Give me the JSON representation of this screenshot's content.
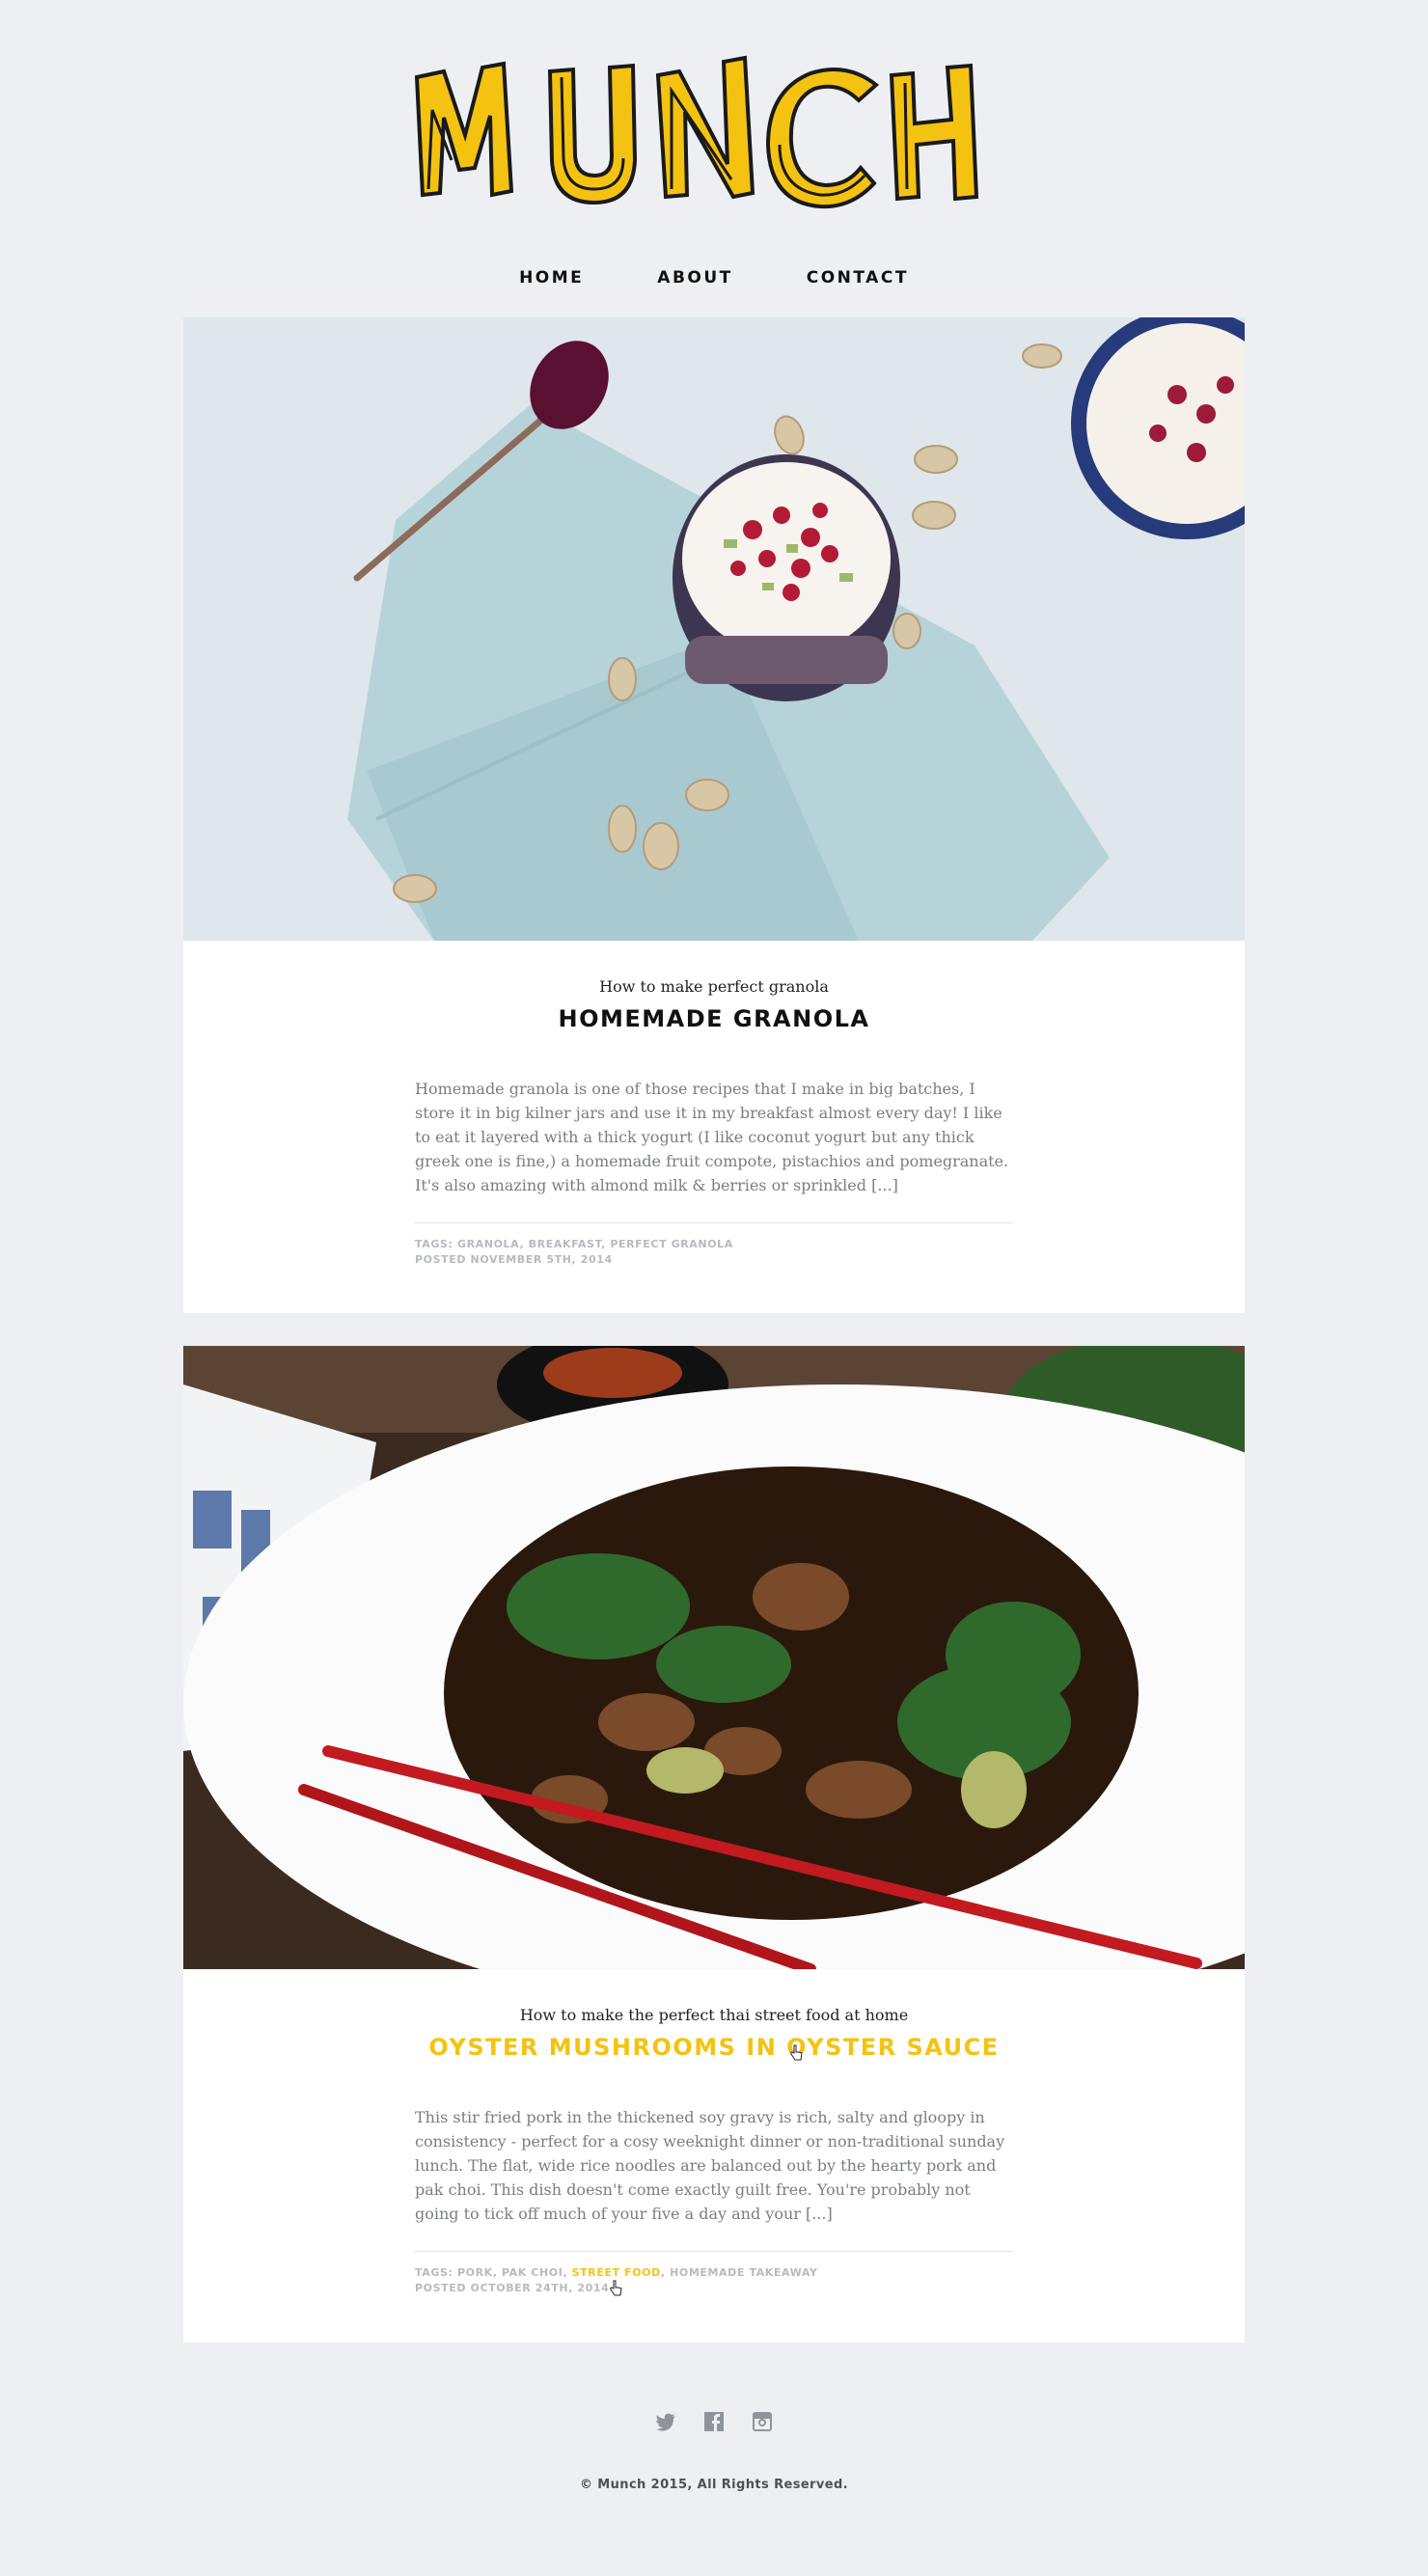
{
  "brand": {
    "logo_text": "MUNCH",
    "accent_color": "#f4c311",
    "background_color": "#edeff3"
  },
  "nav": {
    "items": [
      {
        "label": "HOME"
      },
      {
        "label": "ABOUT"
      },
      {
        "label": "CONTACT"
      }
    ]
  },
  "posts": [
    {
      "subtitle": "How to make perfect granola",
      "title": "HOMEMADE GRANOLA",
      "image_icon": "granola-jar-photo",
      "excerpt": "Homemade granola is one of those recipes that I make in big batches, I store it in big kilner jars and use it in my breakfast almost every day! I like to eat it layered with a thick yogurt (I like coconut yogurt but any thick greek one is fine,) a homemade fruit compote, pistachios and pomegranate. It's also amazing with almond milk & berries or sprinkled [...]",
      "tags_label": "TAGS:",
      "tags": [
        "GRANOLA",
        "BREAKFAST",
        "PERFECT GRANOLA"
      ],
      "posted": "POSTED NOVEMBER 5TH, 2014"
    },
    {
      "subtitle": "How to make the perfect thai street food at home",
      "title": "OYSTER MUSHROOMS IN OYSTER SAUCE",
      "image_icon": "stir-fry-plate-photo",
      "excerpt": "This stir fried pork in the thickened soy gravy is rich, salty and gloopy in consistency - perfect for a cosy weeknight dinner or non-traditional sunday lunch.  The flat, wide rice noodles  are balanced out by the hearty pork and pak choi. This dish doesn't come exactly guilt free. You're probably not going to tick off much of your five a day and your [...]",
      "tags_label": "TAGS:",
      "tags": [
        "PORK",
        "PAK CHOI",
        "STREET FOOD",
        "HOMEMADE TAKEAWAY"
      ],
      "posted": "POSTED OCTOBER 24TH, 2014"
    }
  ],
  "social": {
    "icons": [
      "twitter-icon",
      "facebook-icon",
      "instagram-icon"
    ]
  },
  "footer": {
    "copyright": "© Munch 2015, All Rights Reserved."
  }
}
